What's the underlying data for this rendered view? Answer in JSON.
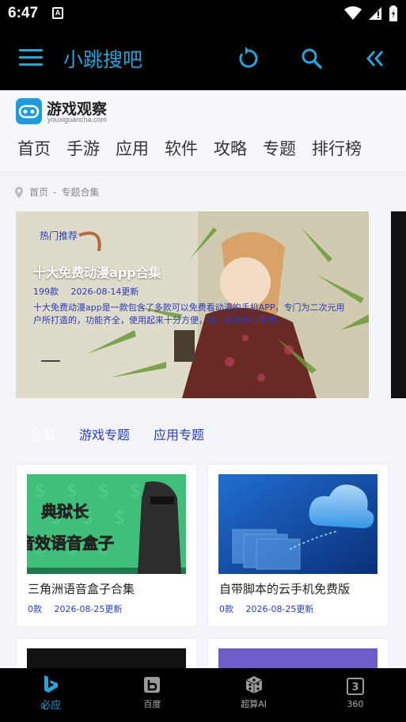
{
  "status_bar": {
    "time": "6:47",
    "notification_letter": "A"
  },
  "app_bar": {
    "title": "小跳搜吧",
    "icons": [
      "menu-icon",
      "refresh-icon",
      "search-icon",
      "double-chevron-left-icon"
    ]
  },
  "site": {
    "logo_name": "游戏观察",
    "logo_domain": "youxiguancha.com",
    "nav": [
      "首页",
      "手游",
      "应用",
      "软件",
      "攻略",
      "专题",
      "排行榜"
    ],
    "breadcrumb": [
      "首页",
      "专题合集"
    ],
    "breadcrumb_sep": "-"
  },
  "banner": {
    "tag": "热门推荐",
    "title": "十大免费动漫app合集",
    "count": "199款",
    "date": "2026-08-14更新",
    "description": "十大免费动漫app是一款包含了多款可以免费看动漫的手机APP，专门为二次元用户所打造的，功能齐全，使用起来十分方便，每一款都完全免费。"
  },
  "tabs": [
    {
      "label": "全部",
      "active": true
    },
    {
      "label": "游戏专题",
      "active": false
    },
    {
      "label": "应用专题",
      "active": false
    }
  ],
  "cards": [
    {
      "title": "三角洲语音盒子合集",
      "count": "0款",
      "date": "2026-08-25更新",
      "thumb_text_1": "典狱长",
      "thumb_text_2": "音效语音盒子"
    },
    {
      "title": "自带脚本的云手机免费版",
      "count": "0款",
      "date": "2026-08-25更新"
    }
  ],
  "bottom_nav": [
    {
      "label": "必应",
      "icon": "bing-icon",
      "active": true
    },
    {
      "label": "百度",
      "icon": "baidu-icon",
      "active": false
    },
    {
      "label": "超算AI",
      "icon": "dice-icon",
      "active": false
    },
    {
      "label": "360",
      "icon": "360-icon",
      "active": false
    }
  ],
  "colors": {
    "accent": "#2aa3d8",
    "link": "#2b3bb8",
    "background": "#f3f5fb"
  }
}
